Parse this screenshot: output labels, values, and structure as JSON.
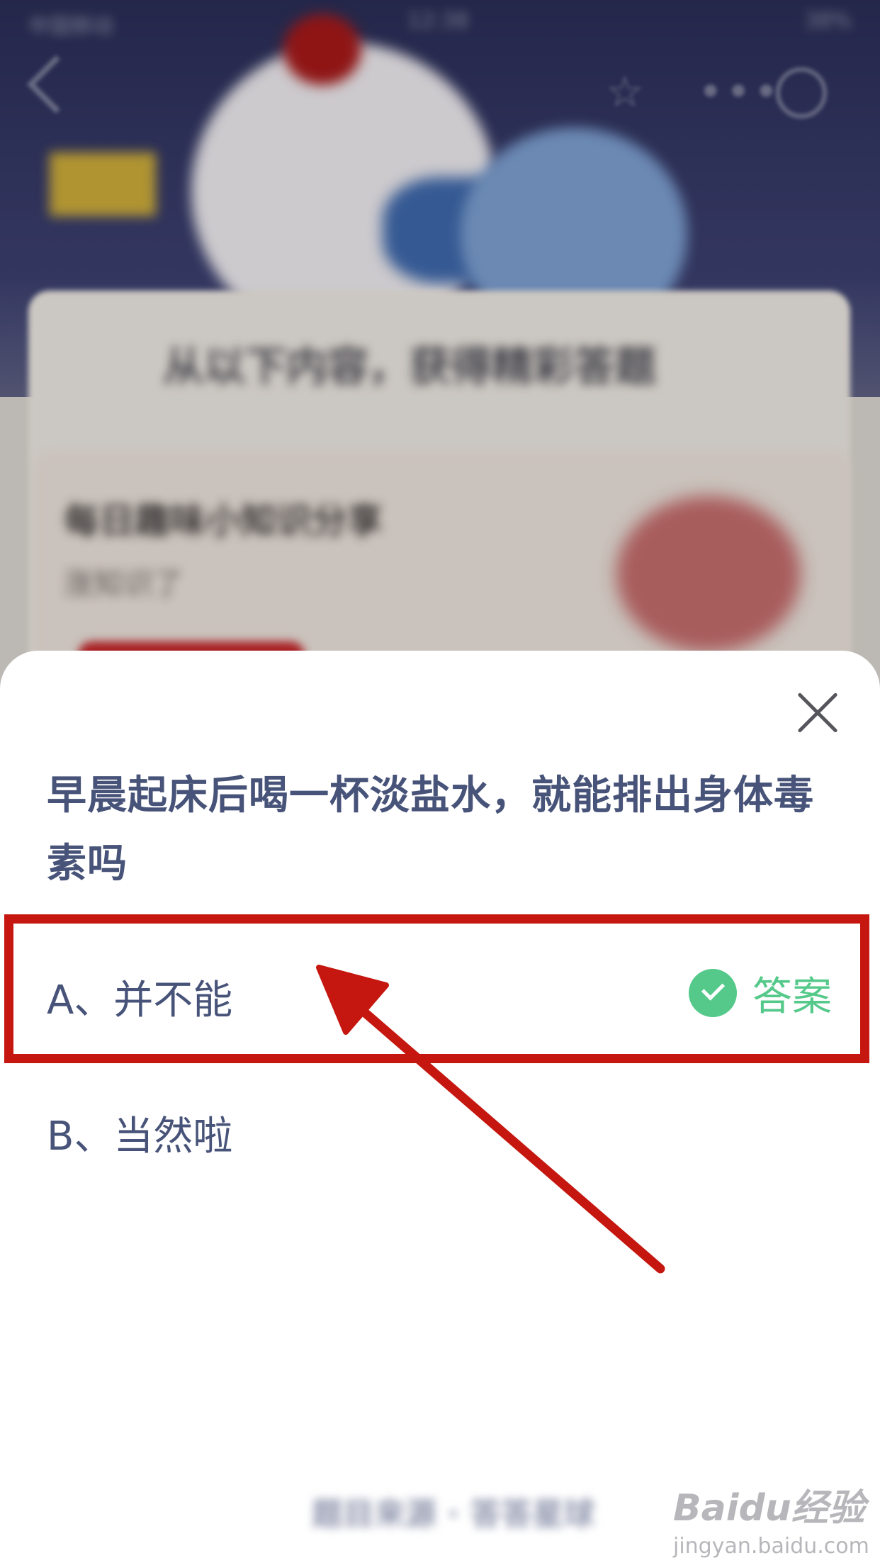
{
  "status_bar": {
    "carrier": "中国移动",
    "time": "12:38",
    "battery": "38%"
  },
  "nav": {
    "star_glyph": "☆",
    "more_glyph": "•••"
  },
  "background": {
    "card_title": "从以下内容，获得精彩答题",
    "subcard_title": "每日趣味小知识分享",
    "subcard_subtitle": "涨知识了"
  },
  "quiz": {
    "question": "早晨起床后喝一杯淡盐水，就能排出身体毒素吗",
    "options": [
      {
        "label": "A、并不能",
        "is_answer": true
      },
      {
        "label": "B、当然啦",
        "is_answer": false
      }
    ],
    "answer_tag": "答案"
  },
  "footer": {
    "blurred_text": "题目来源 · 答答星球"
  },
  "watermark": {
    "brand": "Baidu经验",
    "url": "jingyan.baidu.com"
  },
  "colors": {
    "question_text": "#475378",
    "answer_green": "#55c98a",
    "annotation_red": "#c5170f",
    "sheet_background": "#ffffff"
  },
  "icons": [
    "back-icon",
    "star-icon",
    "more-icon",
    "mini-close-icon",
    "close-icon",
    "check-icon",
    "annotation-arrow"
  ]
}
